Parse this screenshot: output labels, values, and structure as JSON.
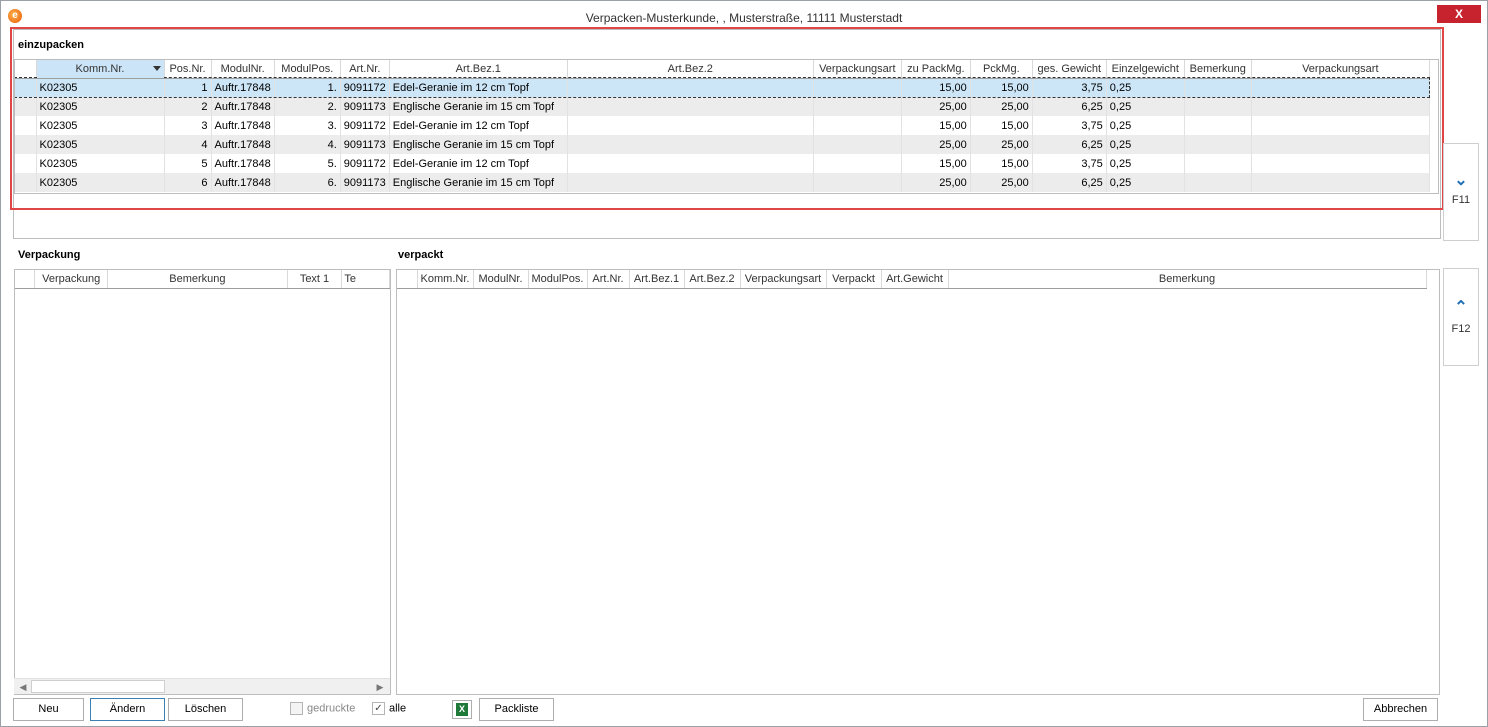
{
  "window": {
    "title": "Verpacken-Musterkunde, , Musterstraße, 11111 Musterstadt",
    "close_label": "X",
    "app_icon_label": "e"
  },
  "einzupacken": {
    "label": "einzupacken",
    "columns": [
      "Komm.Nr.",
      "Pos.Nr.",
      "ModulNr.",
      "ModulPos.",
      "Art.Nr.",
      "Art.Bez.1",
      "Art.Bez.2",
      "Verpackungsart",
      "zu PackMg.",
      "PckMg.",
      "ges. Gewicht",
      "Einzelgewicht",
      "Bemerkung",
      "Verpackungsart"
    ],
    "rows": [
      [
        "K02305",
        "1",
        "Auftr.17848",
        "1.",
        "9091172",
        "Edel-Geranie im 12 cm Topf",
        "",
        "",
        "15,00",
        "15,00",
        "3,75",
        "0,25",
        "",
        ""
      ],
      [
        "K02305",
        "2",
        "Auftr.17848",
        "2.",
        "9091173",
        "Englische Geranie im 15  cm Topf",
        "",
        "",
        "25,00",
        "25,00",
        "6,25",
        "0,25",
        "",
        ""
      ],
      [
        "K02305",
        "3",
        "Auftr.17848",
        "3.",
        "9091172",
        "Edel-Geranie im 12 cm Topf",
        "",
        "",
        "15,00",
        "15,00",
        "3,75",
        "0,25",
        "",
        ""
      ],
      [
        "K02305",
        "4",
        "Auftr.17848",
        "4.",
        "9091173",
        "Englische Geranie im 15  cm Topf",
        "",
        "",
        "25,00",
        "25,00",
        "6,25",
        "0,25",
        "",
        ""
      ],
      [
        "K02305",
        "5",
        "Auftr.17848",
        "5.",
        "9091172",
        "Edel-Geranie im 12 cm Topf",
        "",
        "",
        "15,00",
        "15,00",
        "3,75",
        "0,25",
        "",
        ""
      ],
      [
        "K02305",
        "6",
        "Auftr.17848",
        "6.",
        "9091173",
        "Englische Geranie im 15  cm Topf",
        "",
        "",
        "25,00",
        "25,00",
        "6,25",
        "0,25",
        "",
        ""
      ]
    ]
  },
  "verpackung": {
    "label": "Verpackung",
    "columns": [
      "Verpackung",
      "Bemerkung",
      "Text 1",
      "Te"
    ]
  },
  "verpackt": {
    "label": "verpackt",
    "columns": [
      "Komm.Nr.",
      "ModulNr.",
      "ModulPos.",
      "Art.Nr.",
      "Art.Bez.1",
      "Art.Bez.2",
      "Verpackungsart",
      "Verpackt",
      "Art.Gewicht",
      "Bemerkung"
    ]
  },
  "side_buttons": {
    "down_key": "F11",
    "up_key": "F12"
  },
  "footer": {
    "neu": "Neu",
    "aendern": "Ändern",
    "loeschen": "Löschen",
    "gedruckte": "gedruckte",
    "alle": "alle",
    "packliste": "Packliste",
    "abbrechen": "Abbrechen",
    "excel_icon": "excel-icon"
  }
}
